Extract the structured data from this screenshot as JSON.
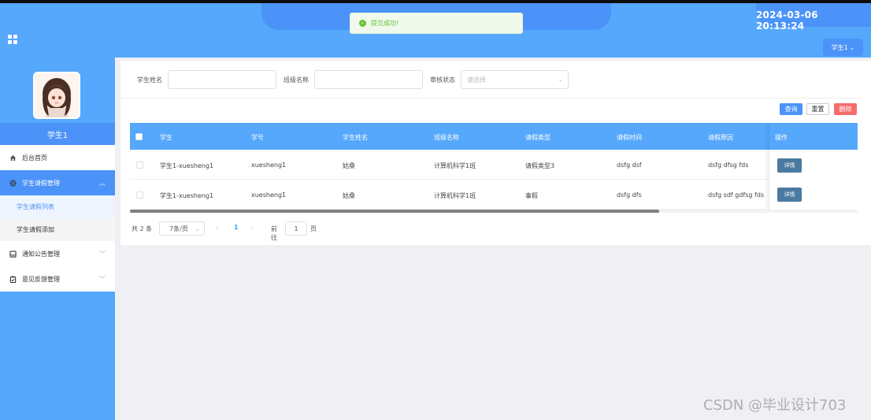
{
  "header": {
    "datetime": "2024-03-06 20:13:24",
    "user_menu_label": "学生1",
    "toast_message": "提交成功!"
  },
  "sidebar": {
    "username": "学生1",
    "items": [
      {
        "label": "后台首页",
        "icon": "home-icon"
      },
      {
        "label": "学生请假管理",
        "icon": "gear-icon",
        "expanded": true,
        "children": [
          {
            "label": "学生请假列表",
            "active": true
          },
          {
            "label": "学生请假添加",
            "active": false
          }
        ]
      },
      {
        "label": "通知公告管理",
        "icon": "inbox-icon"
      },
      {
        "label": "意见反馈管理",
        "icon": "clipboard-icon"
      }
    ]
  },
  "search": {
    "student_name_label": "学生姓名",
    "student_name_value": "",
    "class_name_label": "班级名称",
    "class_name_value": "",
    "review_status_label": "审核状态",
    "review_status_placeholder": "请选择"
  },
  "actions": {
    "query": "查询",
    "reset": "重置",
    "delete": "删除"
  },
  "table": {
    "columns": [
      "学生",
      "学号",
      "学生姓名",
      "班级名称",
      "请假类型",
      "请假时间",
      "请假原因",
      "操作"
    ],
    "rows": [
      [
        "学生1-xuesheng1",
        "xuesheng1",
        "姑桑",
        "计算机科学1班",
        "请假类型3",
        "dsfg dsf",
        "dsfg dfsg fds"
      ],
      [
        "学生1-xuesheng1",
        "xuesheng1",
        "姑桑",
        "计算机科学1班",
        "事假",
        "dsfg dfs",
        "dsfg sdf gdfsg fds"
      ]
    ],
    "row_action": "详情"
  },
  "pagination": {
    "total": "共 2 条",
    "page_size": "7条/页",
    "current_page": "1",
    "goto_label": "前往",
    "goto_value": "1",
    "page_suffix": "页"
  },
  "watermark": "CSDN @毕业设计703",
  "colors": {
    "header": "#55a8fb",
    "accent": "#4b93f8",
    "danger": "#f56c6c",
    "success": "#67c23a"
  }
}
